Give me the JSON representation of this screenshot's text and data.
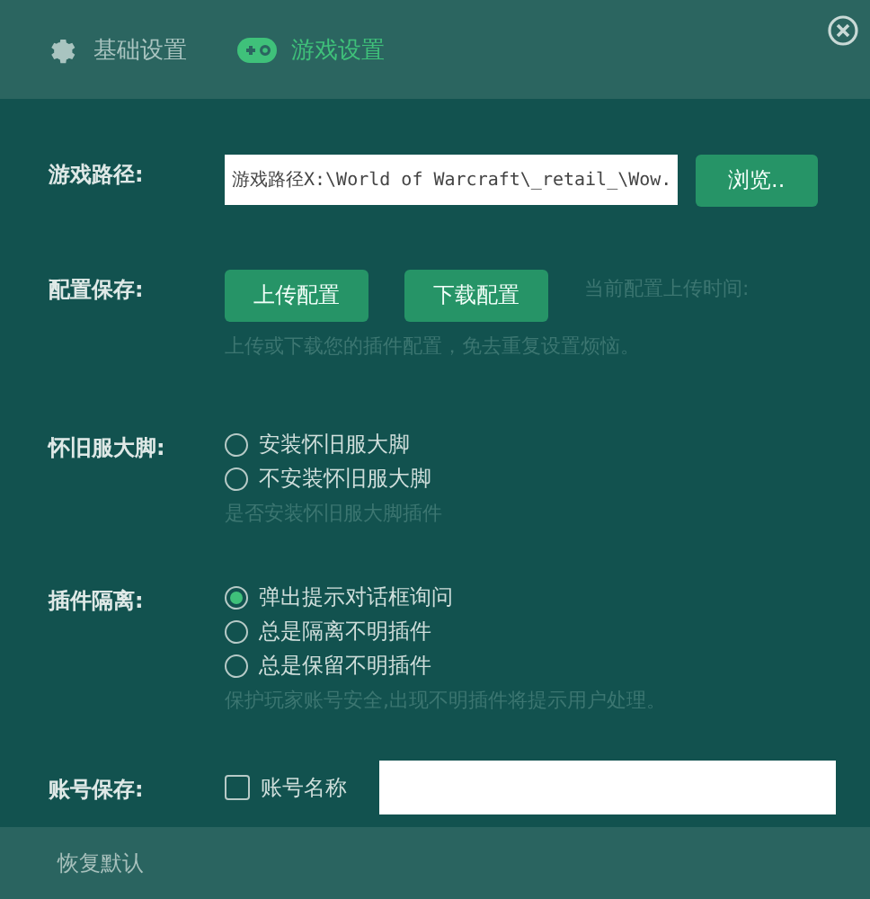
{
  "tabs": [
    {
      "label": "基础设置",
      "kind": "gear",
      "selected": false
    },
    {
      "label": "游戏设置",
      "kind": "gamepad",
      "selected": true
    }
  ],
  "game_path": {
    "label": "游戏路径:",
    "value": "游戏路径X:\\World of Warcraft\\_retail_\\Wow.",
    "button": "浏览.."
  },
  "config_save": {
    "label": "配置保存:",
    "buttons": [
      "上传配置",
      "下载配置"
    ],
    "upload_time": "当前配置上传时间:",
    "hint": "上传或下载您的插件配置，免去重复设置烦恼。"
  },
  "legacy_addon": {
    "label": "怀旧服大脚:",
    "options": [
      {
        "label": "安装怀旧服大脚",
        "selected": false
      },
      {
        "label": "不安装怀旧服大脚",
        "selected": false
      }
    ],
    "hint": "是否安装怀旧服大脚插件"
  },
  "plugin_isolation": {
    "label": "插件隔离:",
    "options": [
      {
        "label": "弹出提示对话框询问",
        "selected": true
      },
      {
        "label": "总是隔离不明插件",
        "selected": false
      },
      {
        "label": "总是保留不明插件",
        "selected": false
      }
    ],
    "hint": "保护玩家账号安全,出现不明插件将提示用户处理。"
  },
  "account_save": {
    "label": "账号保存:",
    "checkbox": {
      "label": "账号名称",
      "checked": false
    }
  },
  "footer": {
    "reset": "恢复默认"
  }
}
